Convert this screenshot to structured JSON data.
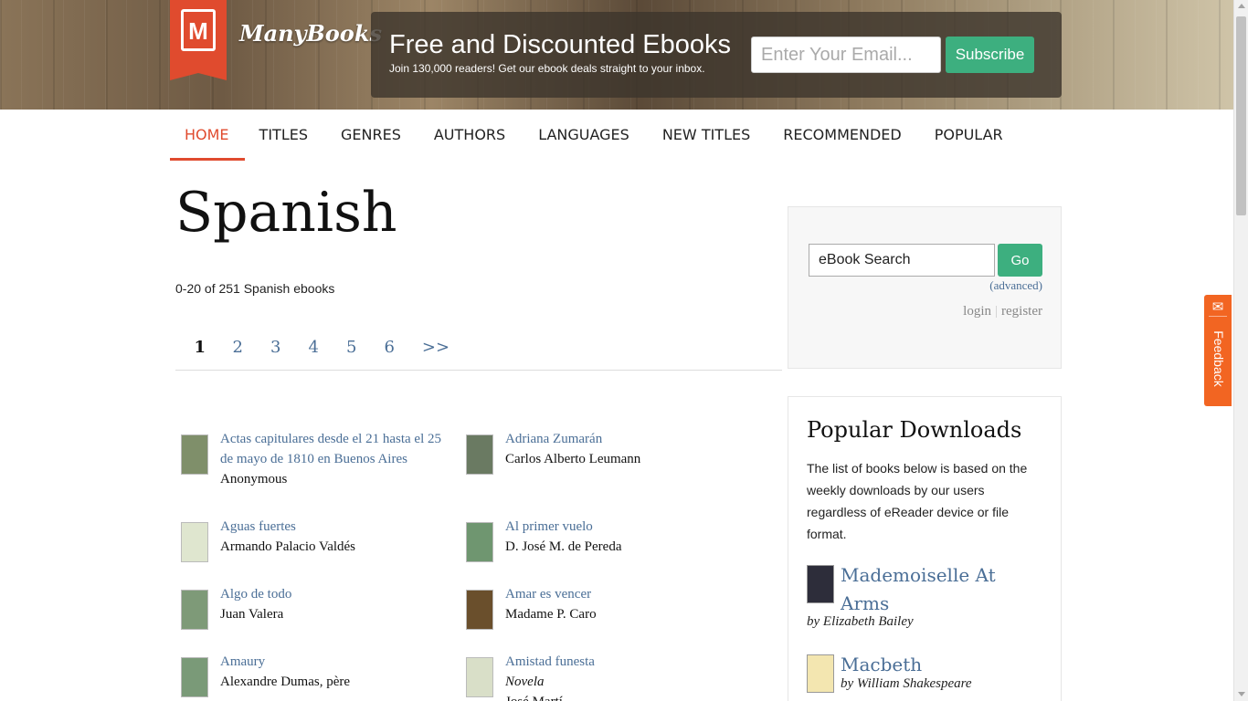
{
  "header": {
    "logo_letter": "M",
    "logo_text": "ManyBooks",
    "promo_title": "Free and Discounted Ebooks",
    "promo_sub": "Join 130,000 readers! Get our ebook deals straight to your inbox.",
    "email_placeholder": "Enter Your Email...",
    "subscribe_label": "Subscribe"
  },
  "nav": {
    "items": [
      {
        "label": "HOME",
        "active": true
      },
      {
        "label": "TITLES"
      },
      {
        "label": "GENRES"
      },
      {
        "label": "AUTHORS"
      },
      {
        "label": "LANGUAGES"
      },
      {
        "label": "NEW TITLES"
      },
      {
        "label": "RECOMMENDED"
      },
      {
        "label": "POPULAR"
      }
    ]
  },
  "main": {
    "title": "Spanish",
    "count": "0-20 of 251 Spanish ebooks",
    "pager": {
      "pages": [
        "1",
        "2",
        "3",
        "4",
        "5",
        "6"
      ],
      "current": "1",
      "next": ">>"
    },
    "books": [
      {
        "title": "Actas capitulares desde el 21 hasta el 25 de mayo de 1810 en Buenos Aires",
        "author": "Anonymous",
        "cover_color": "#7f8f6a"
      },
      {
        "title": "Adriana Zumarán",
        "author": "Carlos Alberto Leumann",
        "cover_color": "#6a7a62"
      },
      {
        "title": "Aguas fuertes",
        "author": "Armando Palacio Valdés",
        "cover_color": "#dfe6cf"
      },
      {
        "title": "Al primer vuelo",
        "author": "D. José M. de Pereda",
        "cover_color": "#6f9670"
      },
      {
        "title": "Algo de todo",
        "author": "Juan Valera",
        "cover_color": "#7e9a78"
      },
      {
        "title": "Amar es vencer",
        "author": "Madame P. Caro",
        "cover_color": "#6a4f2c"
      },
      {
        "title": "Amaury",
        "author": "Alexandre Dumas, père",
        "cover_color": "#7a9a78"
      },
      {
        "title": "Amistad funesta",
        "subtitle": "Novela",
        "author": "José Martí",
        "cover_color": "#d9dfc8"
      }
    ]
  },
  "sidebar": {
    "search_value": "eBook Search",
    "go_label": "Go",
    "advanced_label": "(advanced)",
    "login_label": "login",
    "auth_separator": "|",
    "register_label": "register",
    "popular": {
      "heading": "Popular Downloads",
      "description": "The list of books below is based on the weekly downloads by our users regardless of eReader device or file format.",
      "items": [
        {
          "title": "Mademoiselle At Arms",
          "by": "by Elizabeth Bailey",
          "cover_color": "#2d2d3a"
        },
        {
          "title": "Macbeth",
          "by": "by William Shakespeare",
          "cover_color": "#f3e6b0"
        }
      ]
    }
  },
  "feedback": {
    "label": "Feedback",
    "icon": "megaphone-icon"
  },
  "colors": {
    "accent": "#e04b2e",
    "link": "#4a6e96",
    "button": "#3daf7f",
    "feedback": "#f26522"
  }
}
